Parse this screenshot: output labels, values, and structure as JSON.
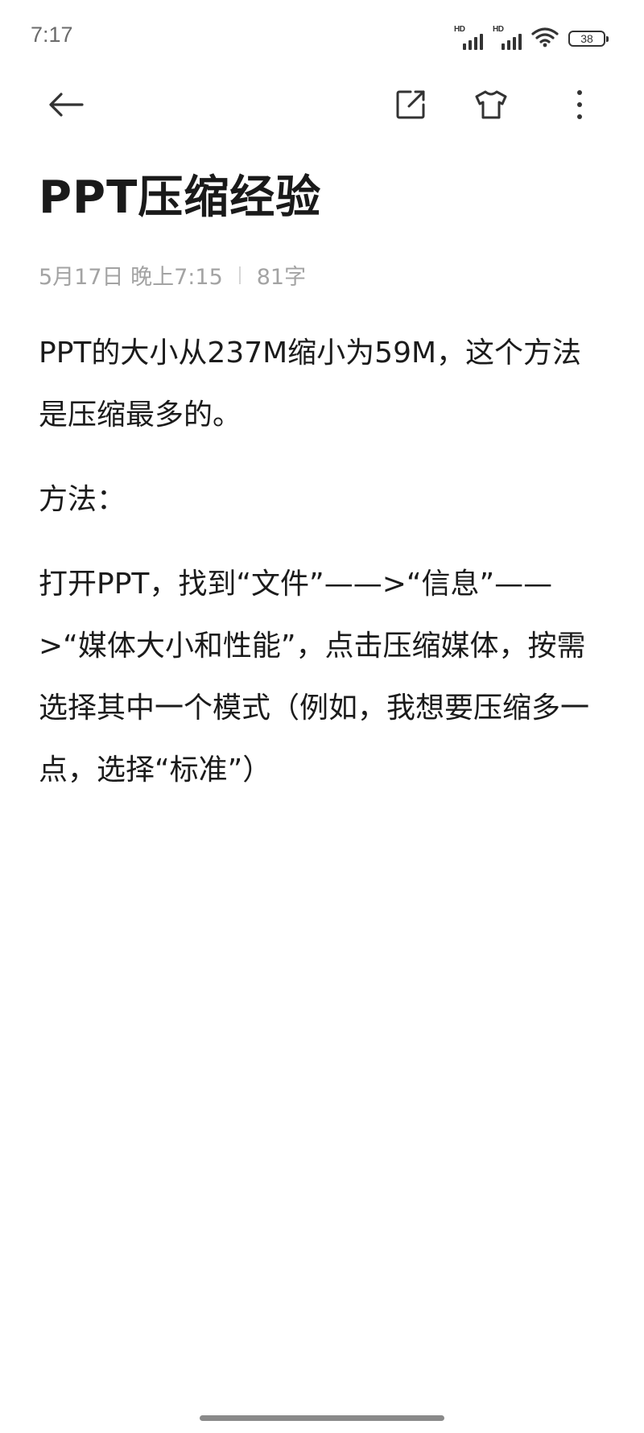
{
  "status_bar": {
    "time": "7:17",
    "signal1_label": "HD",
    "signal2_label": "HD",
    "battery_level": "38",
    "icons": [
      "signal-icon",
      "signal-icon",
      "wifi-icon",
      "battery-icon"
    ]
  },
  "toolbar": {
    "back_icon": "arrow-left-icon",
    "share_icon": "share-external-icon",
    "theme_icon": "tshirt-icon",
    "more_icon": "more-vertical-icon"
  },
  "note": {
    "title": "PPT压缩经验",
    "date": "5月17日 晚上7:15",
    "word_count": "81字",
    "paragraphs": [
      "PPT的大小从237M缩小为59M，这个方法是压缩最多的。",
      "方法：",
      "打开PPT，找到“文件”——>“信息”——>“媒体大小和性能”，点击压缩媒体，按需选择其中一个模式（例如，我想要压缩多一点，选择“标准”）"
    ]
  },
  "colors": {
    "text_primary": "#1b1b1b",
    "text_meta": "#a3a3a3",
    "icon": "#333333",
    "background": "#ffffff"
  }
}
